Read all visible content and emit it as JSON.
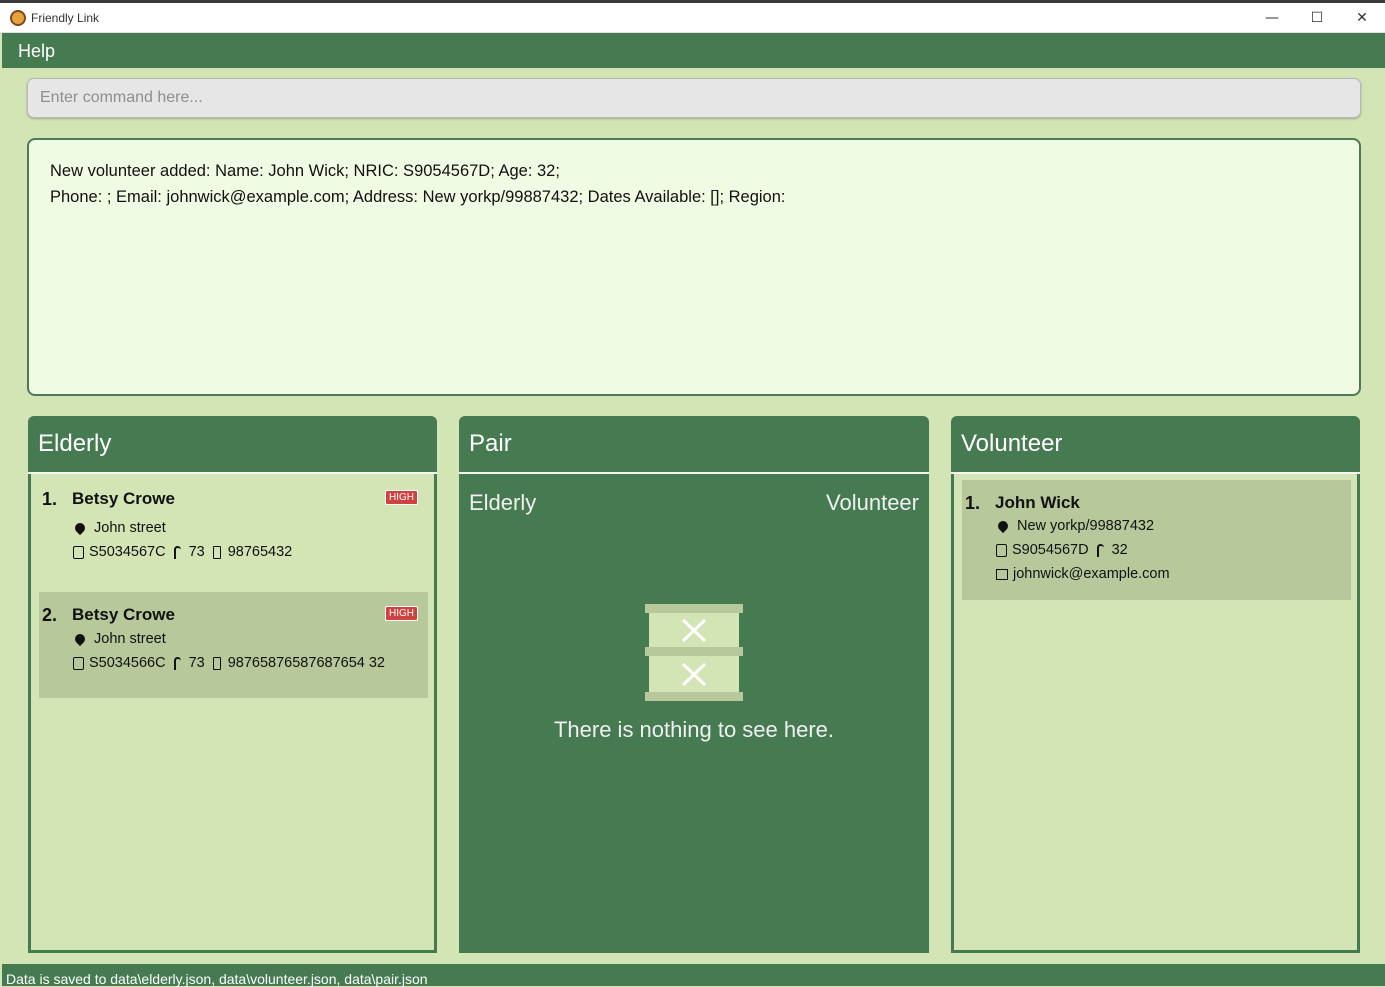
{
  "window": {
    "title": "Friendly Link",
    "minimize": "—",
    "maximize": "☐",
    "close": "✕"
  },
  "menu": {
    "help": "Help"
  },
  "command": {
    "placeholder": "Enter command here..."
  },
  "result": {
    "line1": "New volunteer added: Name: John Wick; NRIC: S9054567D; Age: 32;",
    "line2": "Phone: ; Email: johnwick@example.com; Address: New yorkp/99887432; Dates Available: []; Region:"
  },
  "elderly": {
    "title": "Elderly",
    "items": [
      {
        "index": "1.",
        "name": "Betsy Crowe",
        "risk": "HIGH",
        "address": "John street",
        "nric": "S5034567C",
        "age": "73",
        "phone": "98765432"
      },
      {
        "index": "2.",
        "name": "Betsy Crowe",
        "risk": "HIGH",
        "address": "John street",
        "nric": "S5034566C",
        "age": "73",
        "phone": "98765876587687654 32"
      }
    ]
  },
  "pair": {
    "title": "Pair",
    "col_elderly": "Elderly",
    "col_volunteer": "Volunteer",
    "empty_message": "There is nothing to see here."
  },
  "volunteer": {
    "title": "Volunteer",
    "items": [
      {
        "index": "1.",
        "name": "John Wick",
        "address": "New yorkp/99887432",
        "nric": "S9054567D",
        "age": "32",
        "email": "johnwick@example.com"
      }
    ]
  },
  "status": {
    "text": "Data is saved to data\\elderly.json, data\\volunteer.json, data\\pair.json"
  },
  "colors": {
    "accent": "#467b52",
    "background": "#d3e4b5",
    "card_alt": "#b7c99b",
    "badge_high": "#cf4242",
    "result_bg": "#f0fbe4"
  }
}
